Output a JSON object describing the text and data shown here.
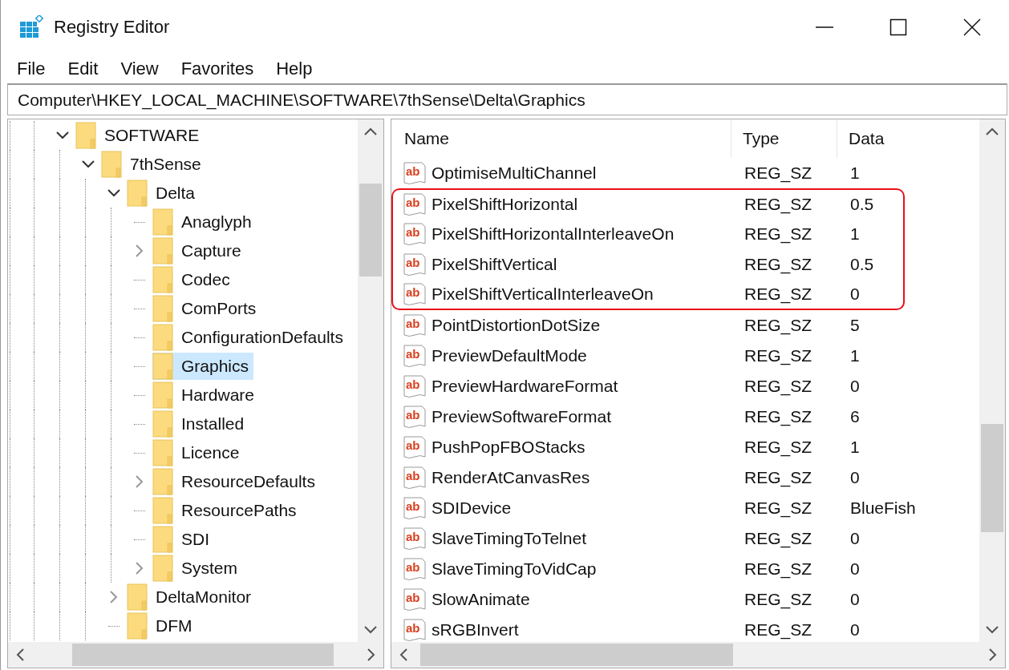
{
  "window": {
    "title": "Registry Editor"
  },
  "menu": [
    {
      "label": "File"
    },
    {
      "label": "Edit"
    },
    {
      "label": "View"
    },
    {
      "label": "Favorites"
    },
    {
      "label": "Help"
    }
  ],
  "address_bar": {
    "value": "Computer\\HKEY_LOCAL_MACHINE\\SOFTWARE\\7thSense\\Delta\\Graphics"
  },
  "tree": {
    "items": [
      {
        "label": "SOFTWARE",
        "kind": "branch",
        "expanded": true,
        "selected": false,
        "children": [
          {
            "label": "7thSense",
            "kind": "branch",
            "expanded": true,
            "selected": false,
            "children": [
              {
                "label": "Delta",
                "kind": "branch",
                "expanded": true,
                "selected": false,
                "children": [
                  {
                    "label": "Anaglyph",
                    "kind": "leaf",
                    "selected": false
                  },
                  {
                    "label": "Capture",
                    "kind": "branch",
                    "expanded": false,
                    "selected": false
                  },
                  {
                    "label": "Codec",
                    "kind": "leaf",
                    "selected": false
                  },
                  {
                    "label": "ComPorts",
                    "kind": "leaf",
                    "selected": false
                  },
                  {
                    "label": "ConfigurationDefaults",
                    "kind": "leaf",
                    "selected": false
                  },
                  {
                    "label": "Graphics",
                    "kind": "leaf",
                    "selected": true
                  },
                  {
                    "label": "Hardware",
                    "kind": "leaf",
                    "selected": false
                  },
                  {
                    "label": "Installed",
                    "kind": "leaf",
                    "selected": false
                  },
                  {
                    "label": "Licence",
                    "kind": "leaf",
                    "selected": false
                  },
                  {
                    "label": "ResourceDefaults",
                    "kind": "branch",
                    "expanded": false,
                    "selected": false
                  },
                  {
                    "label": "ResourcePaths",
                    "kind": "leaf",
                    "selected": false
                  },
                  {
                    "label": "SDI",
                    "kind": "leaf",
                    "selected": false
                  },
                  {
                    "label": "System",
                    "kind": "branch",
                    "expanded": false,
                    "selected": false
                  }
                ]
              },
              {
                "label": "DeltaMonitor",
                "kind": "branch",
                "expanded": false,
                "selected": false
              },
              {
                "label": "DFM",
                "kind": "leaf",
                "selected": false
              }
            ]
          }
        ]
      }
    ]
  },
  "table": {
    "columns": [
      "Name",
      "Type",
      "Data"
    ],
    "rows": [
      {
        "icon": "ab",
        "name": "OptimiseMultiChannel",
        "type": "REG_SZ",
        "data": "1",
        "highlighted": false
      },
      {
        "icon": "ab",
        "name": "PixelShiftHorizontal",
        "type": "REG_SZ",
        "data": "0.5",
        "highlighted": true
      },
      {
        "icon": "ab",
        "name": "PixelShiftHorizontalInterleaveOn",
        "type": "REG_SZ",
        "data": "1",
        "highlighted": true
      },
      {
        "icon": "ab",
        "name": "PixelShiftVertical",
        "type": "REG_SZ",
        "data": "0.5",
        "highlighted": true
      },
      {
        "icon": "ab",
        "name": "PixelShiftVerticalInterleaveOn",
        "type": "REG_SZ",
        "data": "0",
        "highlighted": true
      },
      {
        "icon": "ab",
        "name": "PointDistortionDotSize",
        "type": "REG_SZ",
        "data": "5",
        "highlighted": false
      },
      {
        "icon": "ab",
        "name": "PreviewDefaultMode",
        "type": "REG_SZ",
        "data": "1",
        "highlighted": false
      },
      {
        "icon": "ab",
        "name": "PreviewHardwareFormat",
        "type": "REG_SZ",
        "data": "0",
        "highlighted": false
      },
      {
        "icon": "ab",
        "name": "PreviewSoftwareFormat",
        "type": "REG_SZ",
        "data": "6",
        "highlighted": false
      },
      {
        "icon": "ab",
        "name": "PushPopFBOStacks",
        "type": "REG_SZ",
        "data": "1",
        "highlighted": false
      },
      {
        "icon": "ab",
        "name": "RenderAtCanvasRes",
        "type": "REG_SZ",
        "data": "0",
        "highlighted": false
      },
      {
        "icon": "ab",
        "name": "SDIDevice",
        "type": "REG_SZ",
        "data": "BlueFish",
        "highlighted": false
      },
      {
        "icon": "ab",
        "name": "SlaveTimingToTelnet",
        "type": "REG_SZ",
        "data": "0",
        "highlighted": false
      },
      {
        "icon": "ab",
        "name": "SlaveTimingToVidCap",
        "type": "REG_SZ",
        "data": "0",
        "highlighted": false
      },
      {
        "icon": "ab",
        "name": "SlowAnimate",
        "type": "REG_SZ",
        "data": "0",
        "highlighted": false
      },
      {
        "icon": "ab",
        "name": "sRGBInvert",
        "type": "REG_SZ",
        "data": "0",
        "highlighted": false
      }
    ]
  }
}
